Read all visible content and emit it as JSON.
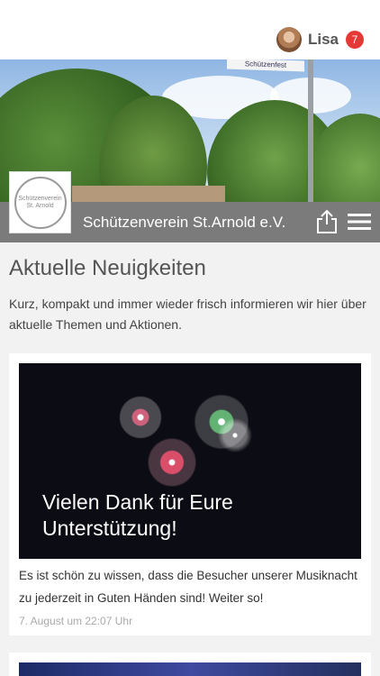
{
  "user": {
    "name": "Lisa",
    "notification_count": "7"
  },
  "hero": {
    "flag_text": "Schützenfest"
  },
  "club": {
    "name": "Schützenverein St.Arnold e.V.",
    "logo_text": "Schützenverein St. Arnold"
  },
  "news": {
    "heading": "Aktuelle Neuigkeiten",
    "intro": "Kurz, kompakt und immer wieder frisch informieren wir hier über aktuelle Themen und Aktionen.",
    "items": [
      {
        "title": "Vielen Dank für Eure Unterstützung!",
        "text": "Es ist schön zu wissen, dass die Besucher unserer Musiknacht zu jederzeit in Guten Händen sind! Weiter so!",
        "date": "7. August um 22:07 Uhr"
      }
    ]
  },
  "icons": {
    "share": "share-icon",
    "menu": "hamburger-menu-icon",
    "avatar": "user-avatar"
  },
  "colors": {
    "badge": "#e53935",
    "namebar": "#7b7b7b"
  }
}
